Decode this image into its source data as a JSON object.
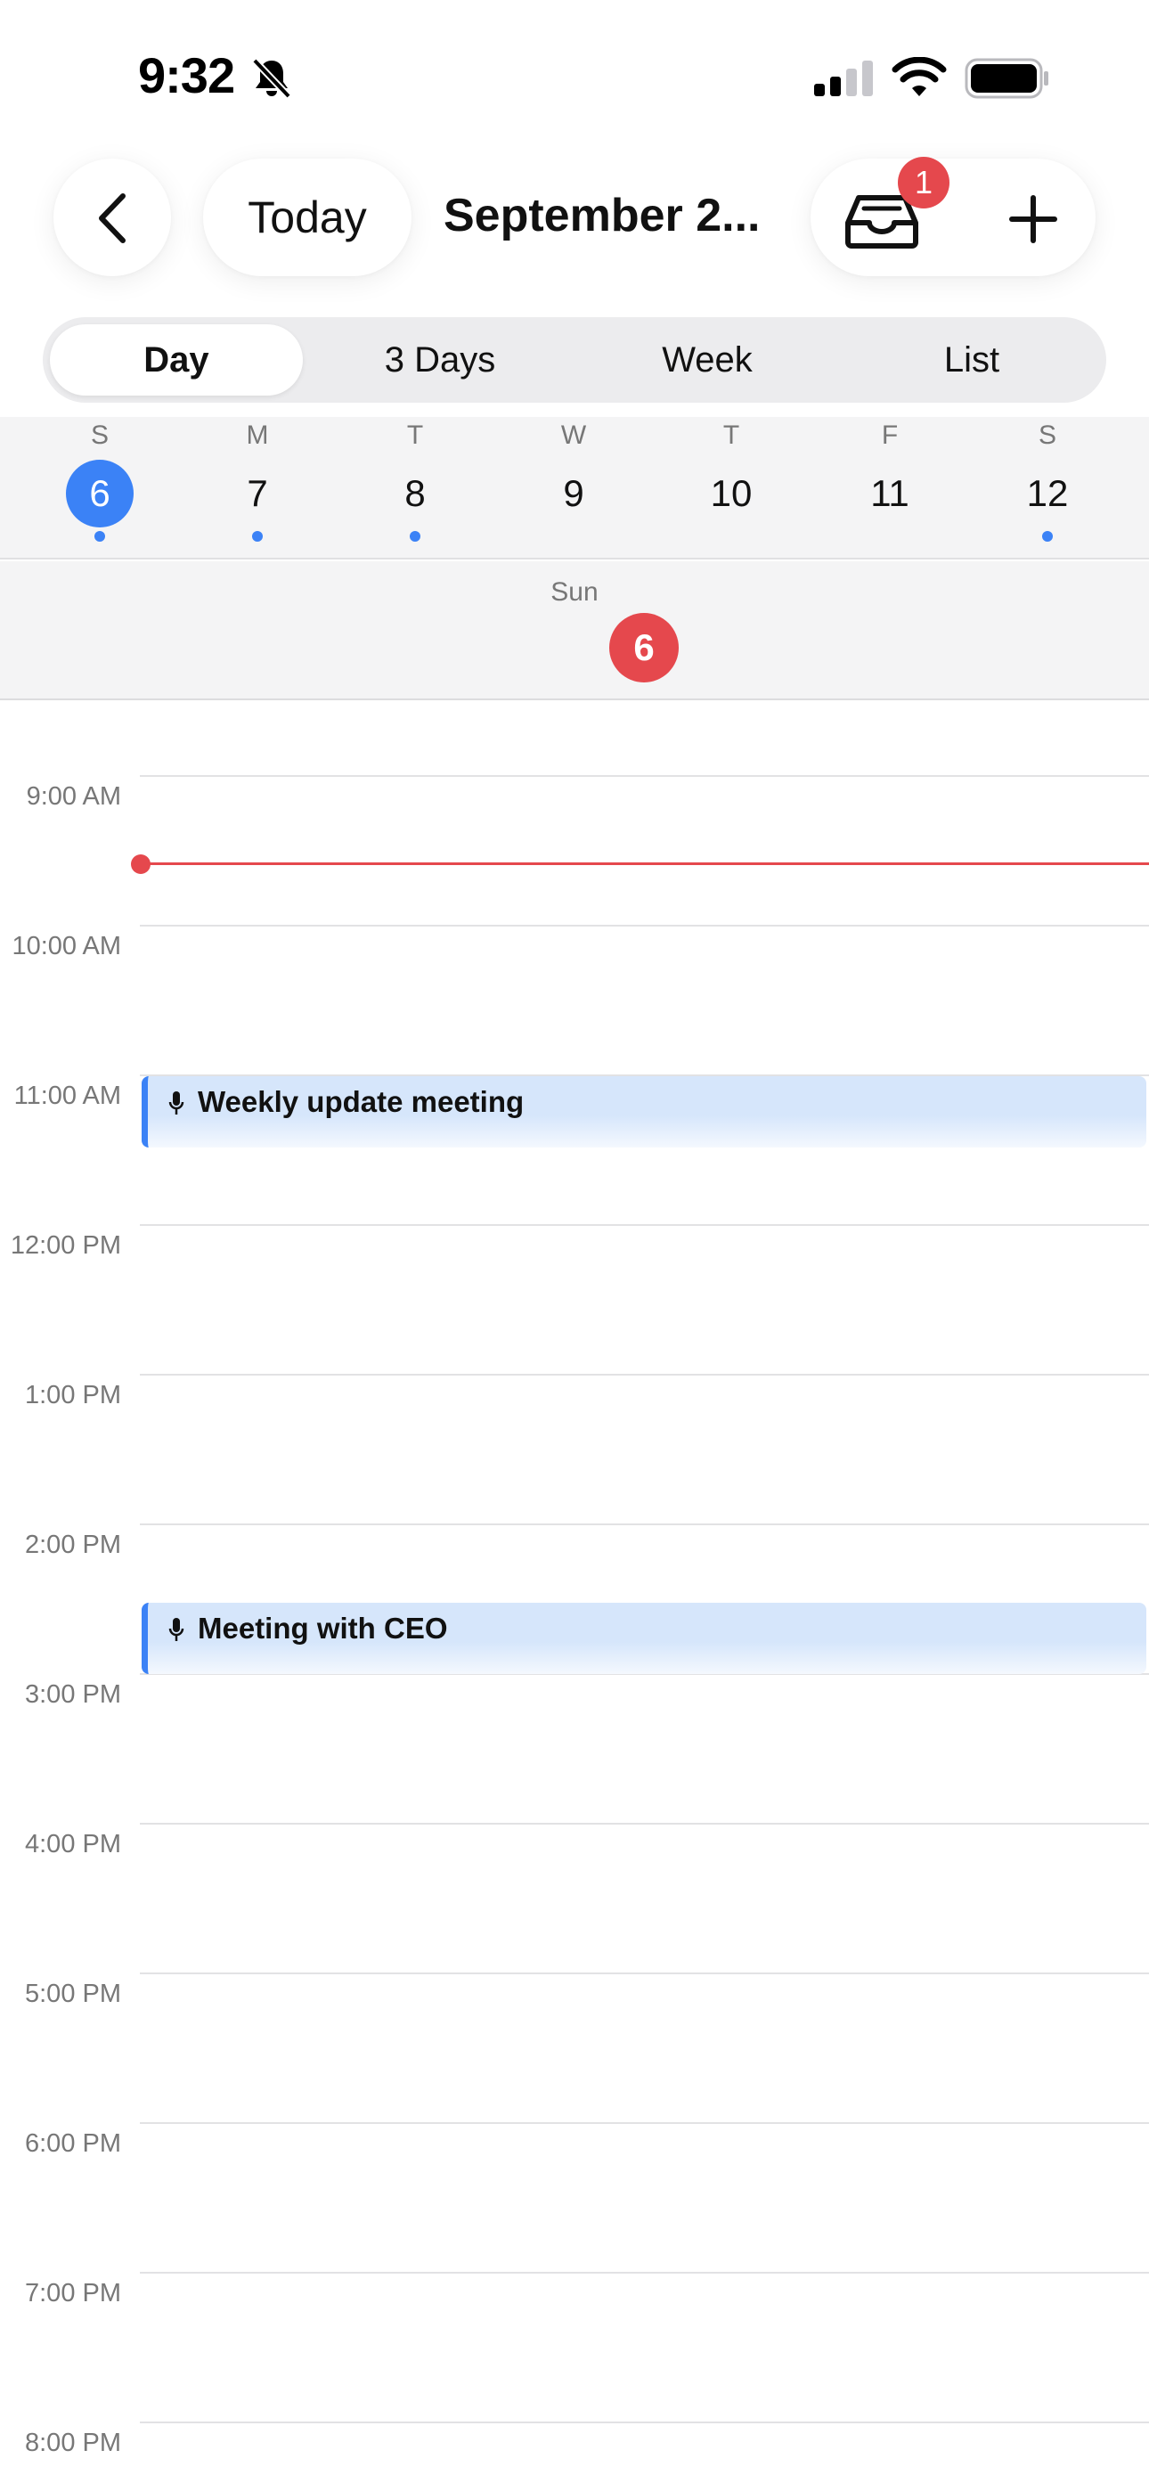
{
  "status_bar": {
    "time": "9:32",
    "icons": [
      "bell-slash-icon",
      "cellular-signal-icon",
      "wifi-icon",
      "battery-icon"
    ]
  },
  "header": {
    "back_icon": "chevron-left-icon",
    "today_label": "Today",
    "title": "September 2...",
    "inbox_icon": "inbox-tray-icon",
    "inbox_badge": "1",
    "add_icon": "plus-icon"
  },
  "view_tabs": [
    {
      "label": "Day",
      "active": true
    },
    {
      "label": "3 Days",
      "active": false
    },
    {
      "label": "Week",
      "active": false
    },
    {
      "label": "List",
      "active": false
    }
  ],
  "week": [
    {
      "letter": "S",
      "num": "6",
      "selected": true,
      "has_event": true
    },
    {
      "letter": "M",
      "num": "7",
      "selected": false,
      "has_event": true
    },
    {
      "letter": "T",
      "num": "8",
      "selected": false,
      "has_event": true
    },
    {
      "letter": "W",
      "num": "9",
      "selected": false,
      "has_event": false
    },
    {
      "letter": "T",
      "num": "10",
      "selected": false,
      "has_event": false
    },
    {
      "letter": "F",
      "num": "11",
      "selected": false,
      "has_event": false
    },
    {
      "letter": "S",
      "num": "12",
      "selected": false,
      "has_event": true
    }
  ],
  "day_header": {
    "name": "Sun",
    "num": "6"
  },
  "hours": [
    "9:00 AM",
    "10:00 AM",
    "11:00 AM",
    "12:00 PM",
    "1:00 PM",
    "2:00 PM",
    "3:00 PM",
    "4:00 PM",
    "5:00 PM",
    "6:00 PM",
    "7:00 PM",
    "8:00 PM"
  ],
  "events": [
    {
      "title": "Weekly update meeting",
      "icon": "microphone-icon"
    },
    {
      "title": "Meeting with CEO",
      "icon": "microphone-icon"
    }
  ],
  "colors": {
    "accent_blue": "#3b82f6",
    "accent_red": "#e5484d",
    "event_fill": "#d6e6fb"
  }
}
